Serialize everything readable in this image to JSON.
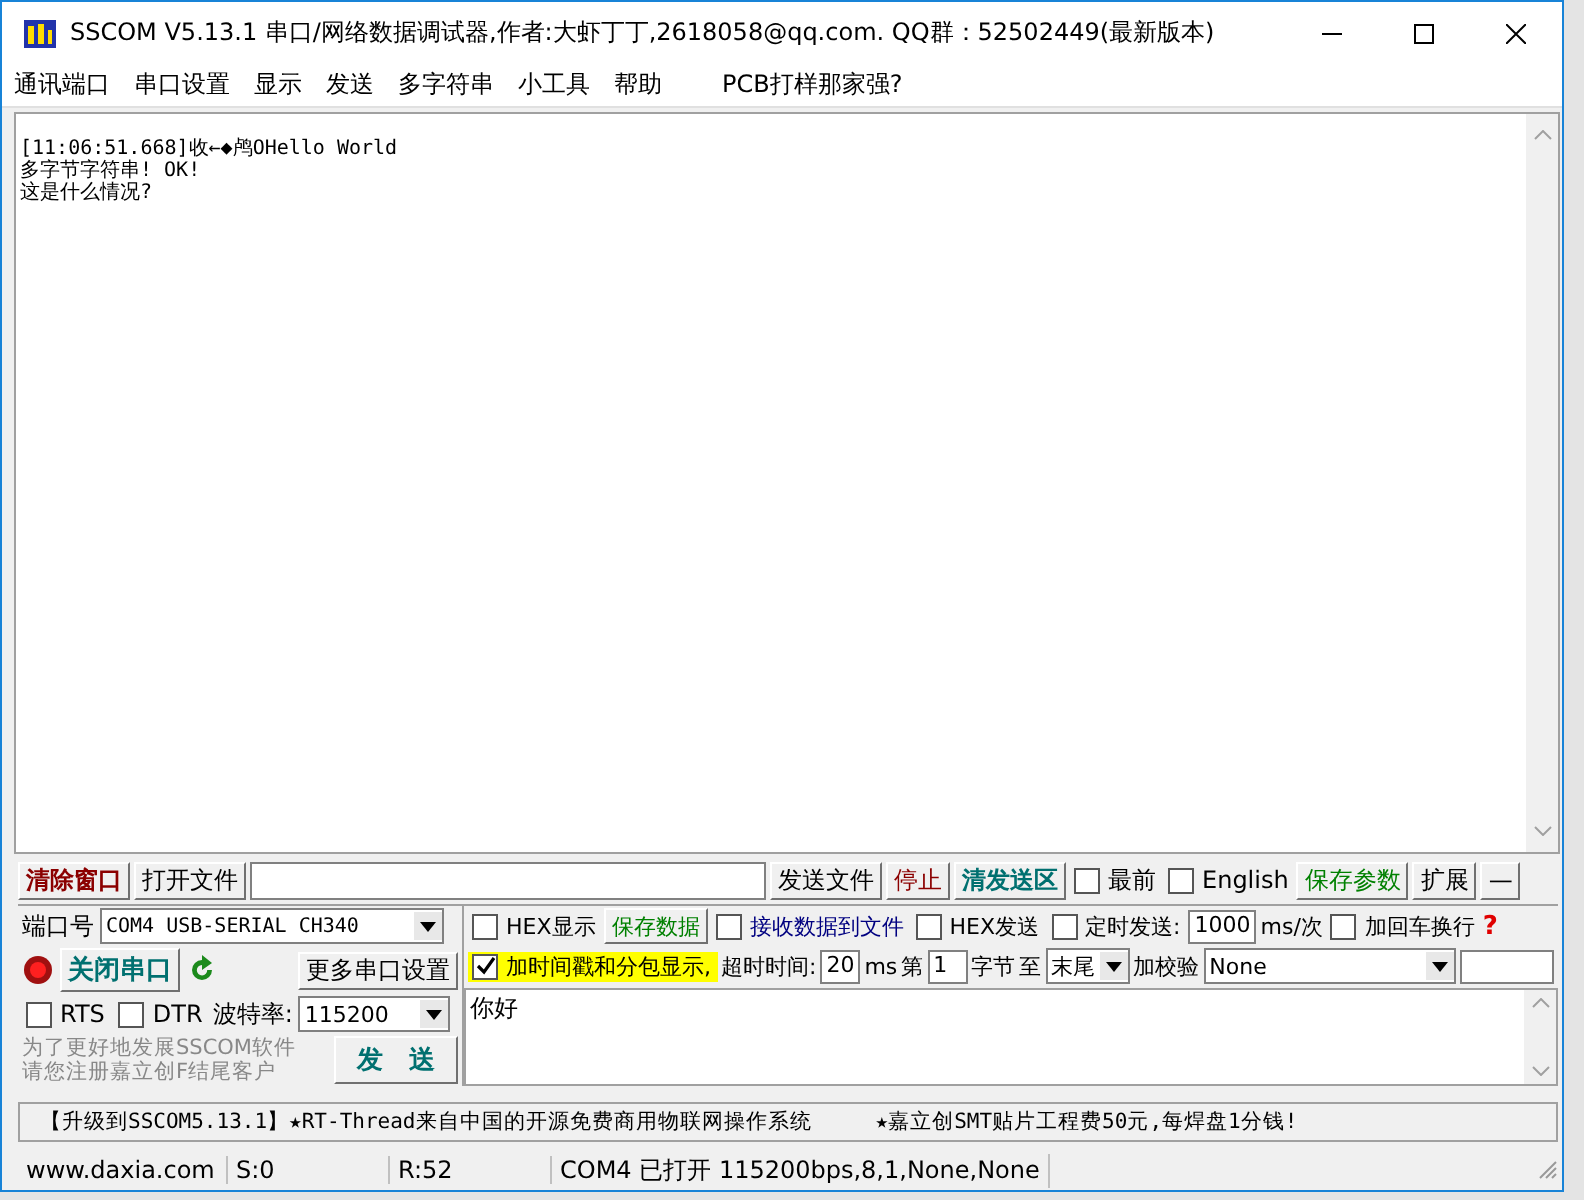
{
  "window": {
    "title": "SSCOM V5.13.1 串口/网络数据调试器,作者:大虾丁丁,2618058@qq.com. QQ群：52502449(最新版本)"
  },
  "menu": [
    "通讯端口",
    "串口设置",
    "显示",
    "发送",
    "多字符串",
    "小工具",
    "帮助",
    "PCB打样那家强?"
  ],
  "receive_lines": [
    "[11:06:51.668]收←◆鸬OHello World",
    "多字节字符串! OK!",
    "这是什么情况?"
  ],
  "toolbar": [
    {
      "kind": "button",
      "label": "清除窗口",
      "color": "#8b0000",
      "bold": true
    },
    {
      "kind": "button",
      "label": "打开文件",
      "color": "#000000",
      "bold": false
    },
    {
      "kind": "field"
    },
    {
      "kind": "button",
      "label": "发送文件",
      "color": "#000000",
      "bold": false
    },
    {
      "kind": "button",
      "label": "停止",
      "color": "#8b0000",
      "bold": false
    },
    {
      "kind": "button",
      "label": "清发送区",
      "color": "#007070",
      "bold": true
    },
    {
      "kind": "checkbox",
      "label": "最前",
      "checked": false
    },
    {
      "kind": "checkbox",
      "label": "English",
      "checked": false
    },
    {
      "kind": "button",
      "label": "保存参数",
      "color": "#008000",
      "bold": false
    },
    {
      "kind": "button",
      "label": "扩展",
      "color": "#000000",
      "bold": false
    },
    {
      "kind": "button",
      "label": "—",
      "color": "#000000",
      "bold": false
    }
  ],
  "port": {
    "label": "端口号",
    "value": "COM4 USB-SERIAL CH340",
    "open": true,
    "toggle_button": "关闭串口",
    "more_button": "更多串口设置",
    "rts": {
      "label": "RTS",
      "checked": false
    },
    "dtr": {
      "label": "DTR",
      "checked": false
    },
    "baud_label": "波特率:",
    "baud_value": "115200"
  },
  "promo_lines": [
    "为了更好地发展SSCOM软件",
    "请您注册嘉立创F结尾客户"
  ],
  "send_button": "发　送",
  "options_row1": [
    {
      "kind": "checkbox",
      "label": "HEX显示",
      "checked": false,
      "color": "#000000"
    },
    {
      "kind": "button",
      "label": "保存数据",
      "color": "#008000",
      "bold": false
    },
    {
      "kind": "checkbox",
      "label": "接收数据到文件",
      "checked": false,
      "color": "#000080"
    },
    {
      "kind": "checkbox",
      "label": "HEX发送",
      "checked": false,
      "color": "#000000"
    },
    {
      "kind": "checkbox",
      "label": "定时发送:",
      "checked": false,
      "color": "#000000"
    },
    {
      "kind": "input",
      "value": "1000"
    },
    {
      "kind": "text",
      "label": "ms/次"
    },
    {
      "kind": "checkbox",
      "label": "加回车换行",
      "checked": false,
      "color": "#000000"
    },
    {
      "kind": "help",
      "label": "?"
    }
  ],
  "timestamp": {
    "label": "加时间戳和分包显示,",
    "checked": true
  },
  "options_row2": [
    {
      "kind": "text",
      "label": "超时时间:"
    },
    {
      "kind": "input",
      "value": "20"
    },
    {
      "kind": "text",
      "label": "ms"
    },
    {
      "kind": "text",
      "label": "第"
    },
    {
      "kind": "input",
      "value": "1"
    },
    {
      "kind": "text",
      "label": "字节"
    },
    {
      "kind": "text",
      "label": "至"
    },
    {
      "kind": "select",
      "value": "末尾"
    },
    {
      "kind": "text",
      "label": "加校验"
    },
    {
      "kind": "select",
      "value": "None"
    },
    {
      "kind": "input"
    }
  ],
  "send_text": "你好",
  "ticker": [
    "【升级到SSCOM5.13.1】★RT-Thread来自中国的开源免费商用物联网操作系统",
    "★嘉立创SMT贴片工程费50元,每焊盘1分钱!"
  ],
  "status_bar": [
    "www.daxia.com",
    "S:0",
    "R:52",
    "COM4 已打开  115200bps,8,1,None,None"
  ]
}
